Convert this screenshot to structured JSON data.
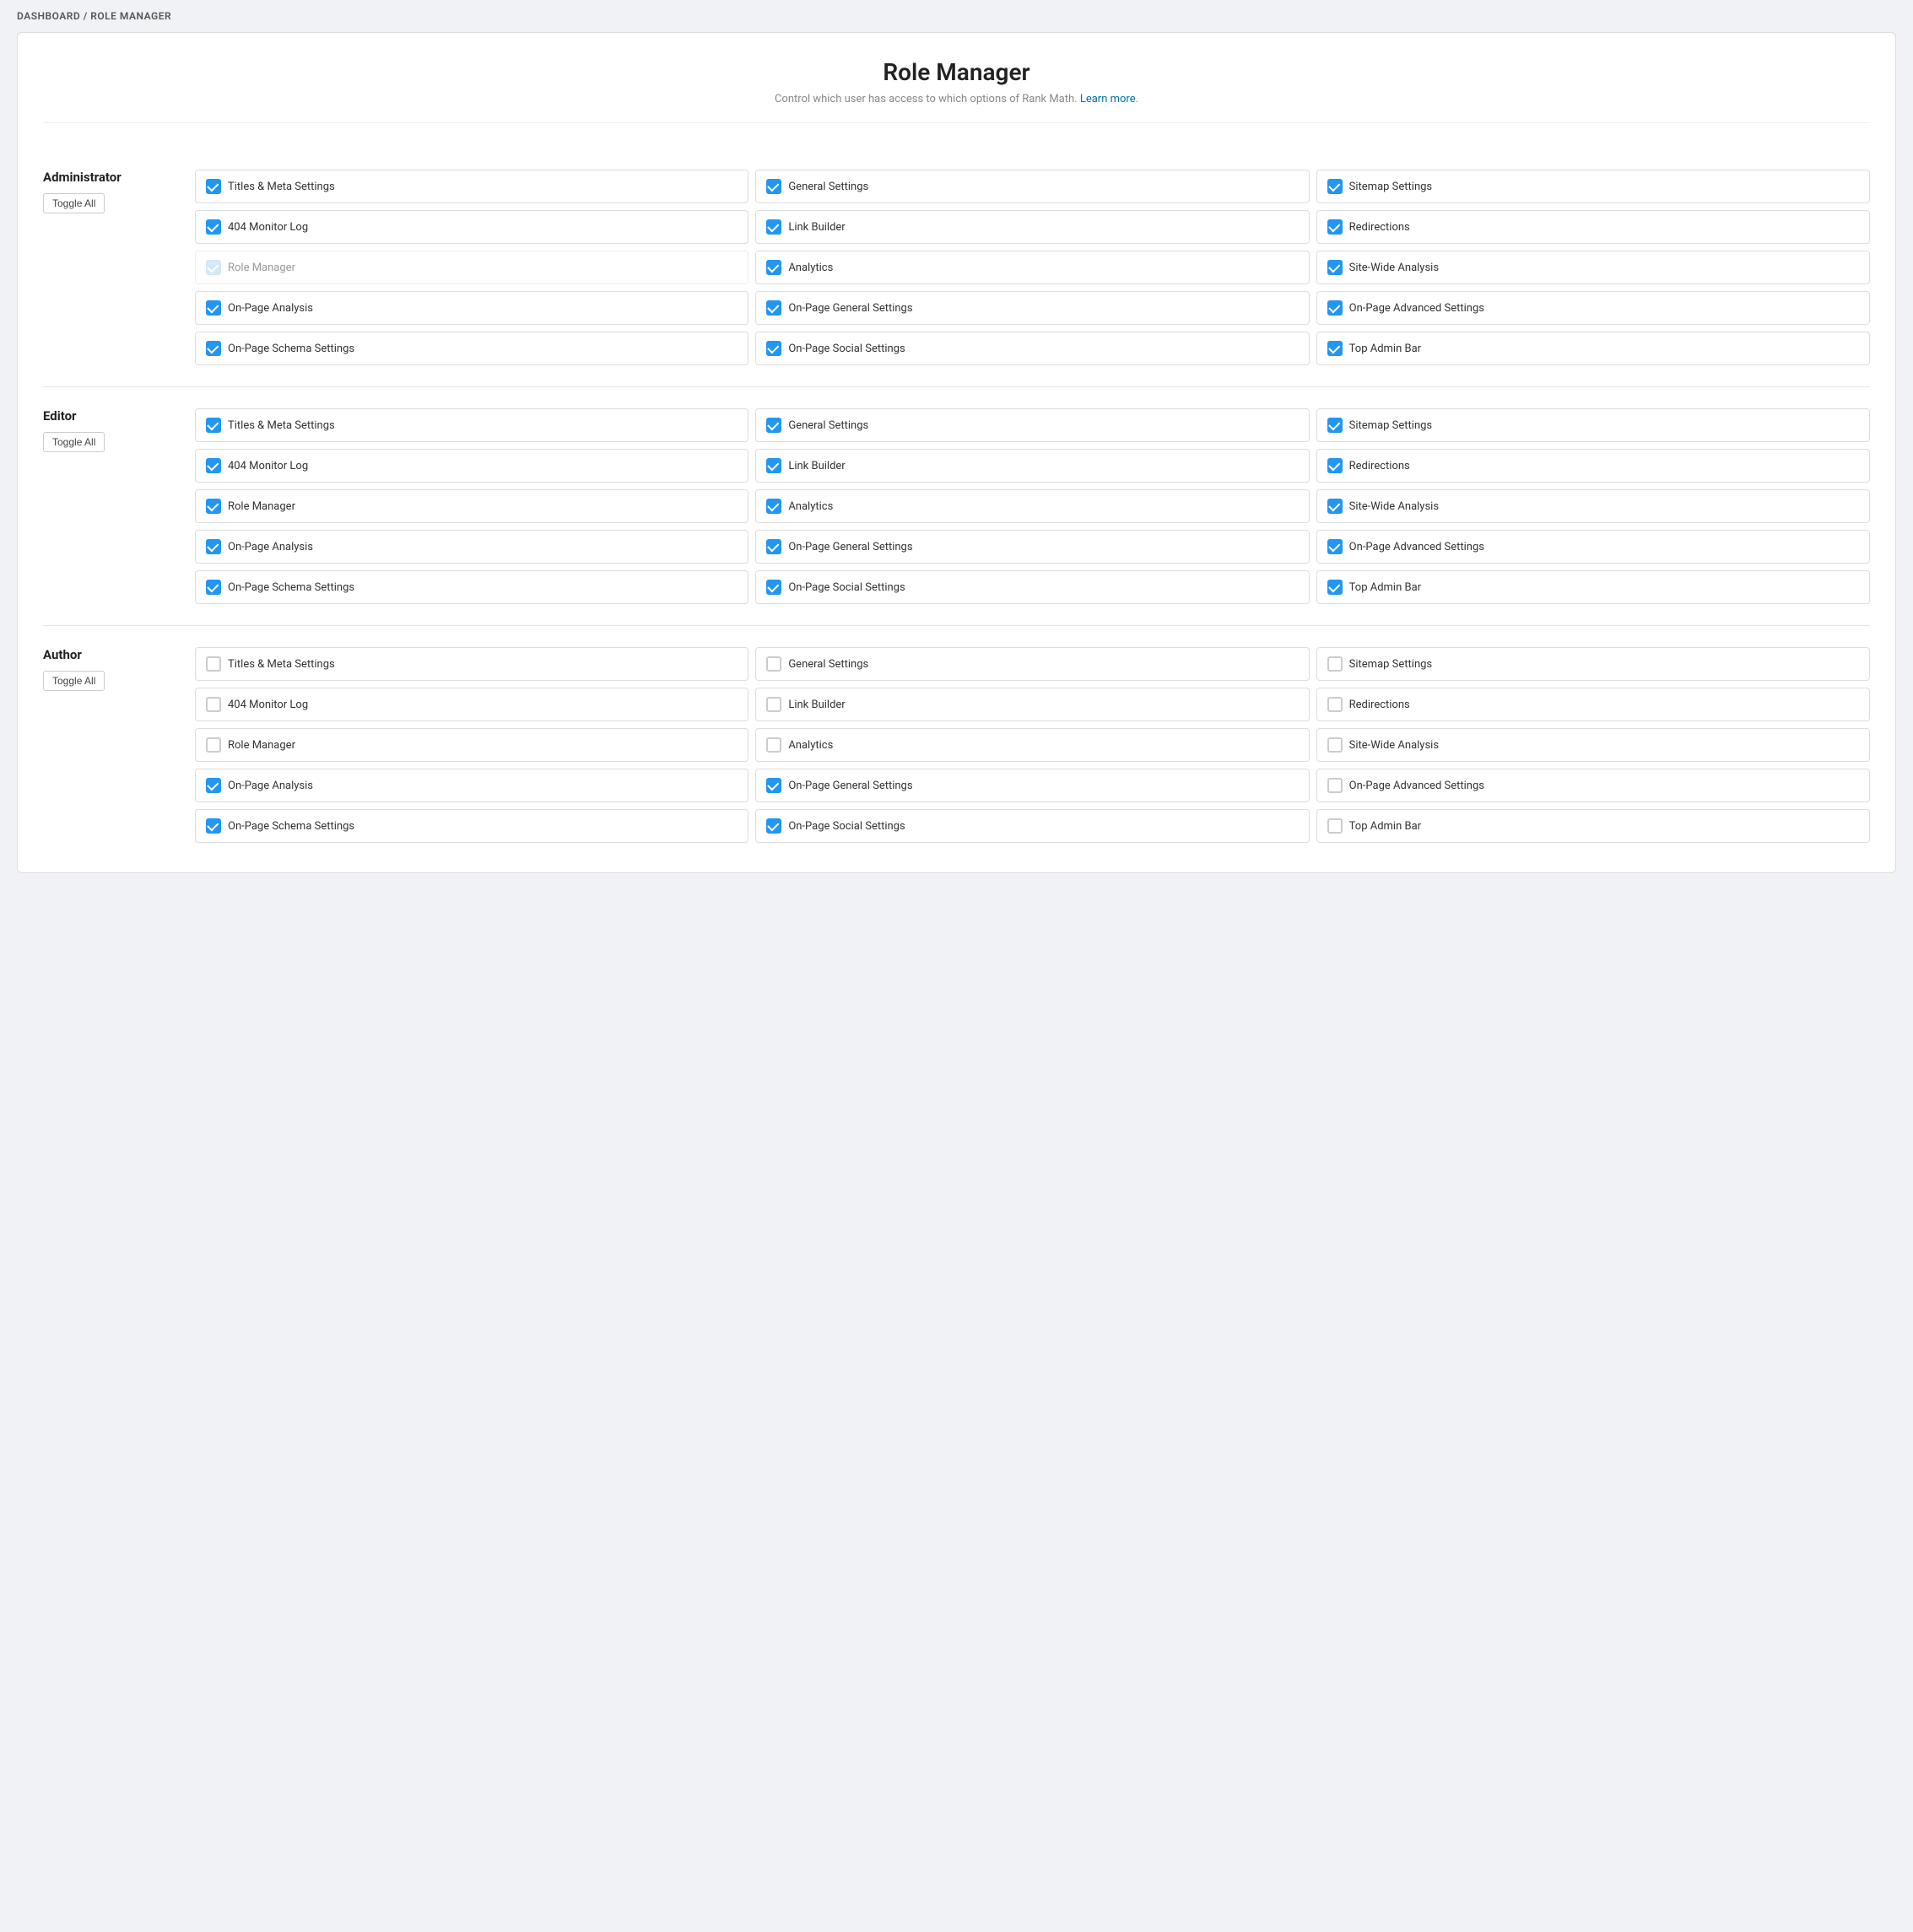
{
  "breadcrumb": {
    "dashboard": "Dashboard",
    "separator": "/",
    "current": "Role Manager"
  },
  "page": {
    "title": "Role Manager",
    "subtitle": "Control which user has access to which options of Rank Math.",
    "learn_more": "Learn more",
    "learn_more_url": "#"
  },
  "roles": [
    {
      "id": "administrator",
      "name": "Administrator",
      "toggle_label": "Toggle All",
      "permissions": [
        {
          "id": "titles-meta",
          "label": "Titles & Meta Settings",
          "state": "checked"
        },
        {
          "id": "general-settings",
          "label": "General Settings",
          "state": "checked"
        },
        {
          "id": "sitemap-settings",
          "label": "Sitemap Settings",
          "state": "checked"
        },
        {
          "id": "404-monitor",
          "label": "404 Monitor Log",
          "state": "checked"
        },
        {
          "id": "link-builder",
          "label": "Link Builder",
          "state": "checked"
        },
        {
          "id": "redirections",
          "label": "Redirections",
          "state": "checked"
        },
        {
          "id": "role-manager",
          "label": "Role Manager",
          "state": "checked-disabled"
        },
        {
          "id": "analytics",
          "label": "Analytics",
          "state": "checked"
        },
        {
          "id": "site-wide-analysis",
          "label": "Site-Wide Analysis",
          "state": "checked"
        },
        {
          "id": "onpage-analysis",
          "label": "On-Page Analysis",
          "state": "checked"
        },
        {
          "id": "onpage-general",
          "label": "On-Page General Settings",
          "state": "checked"
        },
        {
          "id": "onpage-advanced",
          "label": "On-Page Advanced Settings",
          "state": "checked"
        },
        {
          "id": "onpage-schema",
          "label": "On-Page Schema Settings",
          "state": "checked"
        },
        {
          "id": "onpage-social",
          "label": "On-Page Social Settings",
          "state": "checked"
        },
        {
          "id": "top-admin-bar",
          "label": "Top Admin Bar",
          "state": "checked"
        }
      ]
    },
    {
      "id": "editor",
      "name": "Editor",
      "toggle_label": "Toggle All",
      "permissions": [
        {
          "id": "titles-meta",
          "label": "Titles & Meta Settings",
          "state": "checked"
        },
        {
          "id": "general-settings",
          "label": "General Settings",
          "state": "checked"
        },
        {
          "id": "sitemap-settings",
          "label": "Sitemap Settings",
          "state": "checked"
        },
        {
          "id": "404-monitor",
          "label": "404 Monitor Log",
          "state": "checked"
        },
        {
          "id": "link-builder",
          "label": "Link Builder",
          "state": "checked"
        },
        {
          "id": "redirections",
          "label": "Redirections",
          "state": "checked"
        },
        {
          "id": "role-manager",
          "label": "Role Manager",
          "state": "checked"
        },
        {
          "id": "analytics",
          "label": "Analytics",
          "state": "checked"
        },
        {
          "id": "site-wide-analysis",
          "label": "Site-Wide Analysis",
          "state": "checked"
        },
        {
          "id": "onpage-analysis",
          "label": "On-Page Analysis",
          "state": "checked"
        },
        {
          "id": "onpage-general",
          "label": "On-Page General Settings",
          "state": "checked"
        },
        {
          "id": "onpage-advanced",
          "label": "On-Page Advanced Settings",
          "state": "checked"
        },
        {
          "id": "onpage-schema",
          "label": "On-Page Schema Settings",
          "state": "checked"
        },
        {
          "id": "onpage-social",
          "label": "On-Page Social Settings",
          "state": "checked"
        },
        {
          "id": "top-admin-bar",
          "label": "Top Admin Bar",
          "state": "checked"
        }
      ]
    },
    {
      "id": "author",
      "name": "Author",
      "toggle_label": "Toggle All",
      "permissions": [
        {
          "id": "titles-meta",
          "label": "Titles & Meta Settings",
          "state": "unchecked"
        },
        {
          "id": "general-settings",
          "label": "General Settings",
          "state": "unchecked"
        },
        {
          "id": "sitemap-settings",
          "label": "Sitemap Settings",
          "state": "unchecked"
        },
        {
          "id": "404-monitor",
          "label": "404 Monitor Log",
          "state": "unchecked"
        },
        {
          "id": "link-builder",
          "label": "Link Builder",
          "state": "unchecked"
        },
        {
          "id": "redirections",
          "label": "Redirections",
          "state": "unchecked"
        },
        {
          "id": "role-manager",
          "label": "Role Manager",
          "state": "unchecked"
        },
        {
          "id": "analytics",
          "label": "Analytics",
          "state": "unchecked"
        },
        {
          "id": "site-wide-analysis",
          "label": "Site-Wide Analysis",
          "state": "unchecked"
        },
        {
          "id": "onpage-analysis",
          "label": "On-Page Analysis",
          "state": "checked"
        },
        {
          "id": "onpage-general",
          "label": "On-Page General Settings",
          "state": "checked"
        },
        {
          "id": "onpage-advanced",
          "label": "On-Page Advanced Settings",
          "state": "unchecked"
        },
        {
          "id": "onpage-schema",
          "label": "On-Page Schema Settings",
          "state": "checked"
        },
        {
          "id": "onpage-social",
          "label": "On-Page Social Settings",
          "state": "checked"
        },
        {
          "id": "top-admin-bar",
          "label": "Top Admin Bar",
          "state": "unchecked"
        }
      ]
    }
  ]
}
